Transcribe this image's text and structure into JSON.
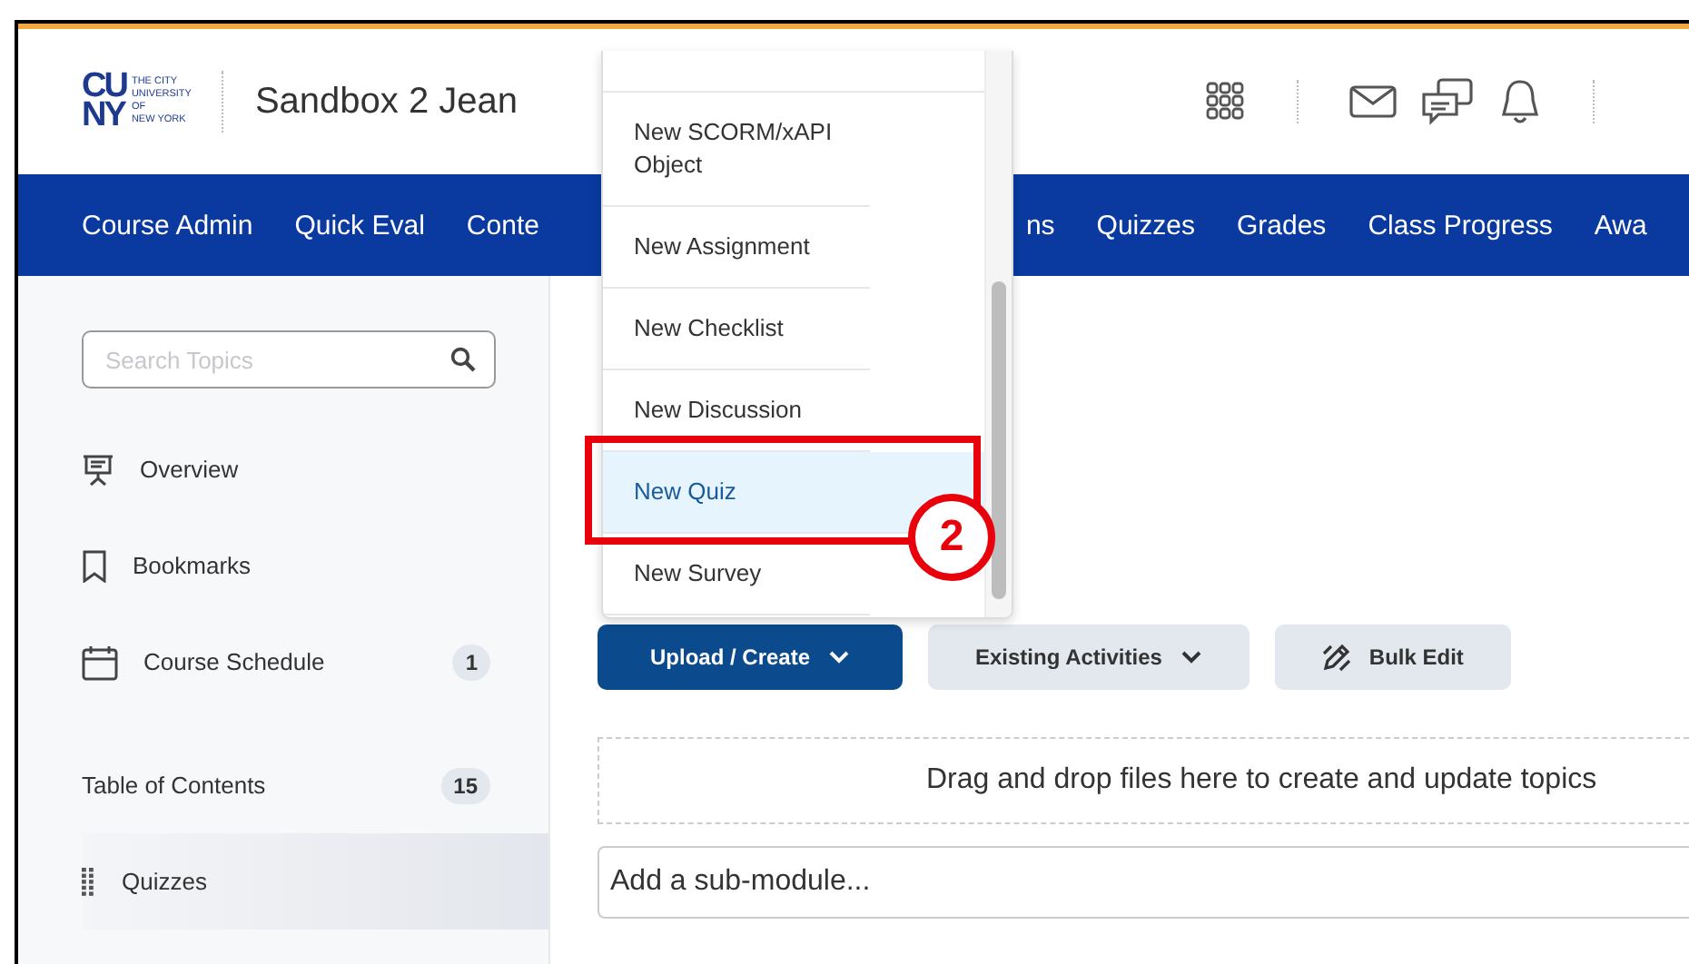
{
  "header": {
    "logo": {
      "mark_lines": [
        "CU",
        "NY"
      ],
      "name_lines": [
        "THE CITY",
        "UNIVERSITY",
        "OF",
        "NEW YORK"
      ]
    },
    "course_title": "Sandbox 2 Jean"
  },
  "nav": {
    "items": [
      "Course Admin",
      "Quick Eval",
      "Conte"
    ],
    "items_after_menu": [
      "ns",
      "Quizzes",
      "Grades",
      "Class Progress",
      "Awa"
    ]
  },
  "sidebar": {
    "search": {
      "placeholder": "Search Topics"
    },
    "items": [
      {
        "kind": "overview",
        "label": "Overview",
        "selected": false
      },
      {
        "kind": "bookmarks",
        "label": "Bookmarks",
        "selected": false
      },
      {
        "kind": "schedule",
        "label": "Course Schedule",
        "count": "1",
        "selected": false
      },
      {
        "kind": "heading",
        "label": "Table of Contents",
        "count": "15",
        "selected": false
      },
      {
        "kind": "module",
        "label": "Quizzes",
        "selected": true
      }
    ]
  },
  "toolbar": {
    "buttons": [
      {
        "kind": "primary",
        "label": "Upload / Create"
      },
      {
        "kind": "dropdown",
        "label": "Existing Activities"
      },
      {
        "kind": "edit",
        "label": "Bulk Edit"
      }
    ]
  },
  "drop_zone": "Drag and drop files here to create and update topics",
  "submodule_field": {
    "placeholder": "Add a sub-module..."
  },
  "menu": {
    "items": [
      {
        "label": "New SCORM/xAPI Object",
        "selected": false
      },
      {
        "label": "New Assignment",
        "selected": false
      },
      {
        "label": "New Checklist",
        "selected": false
      },
      {
        "label": "New Discussion",
        "selected": false
      },
      {
        "label": "New Quiz",
        "selected": true
      },
      {
        "label": "New Survey",
        "selected": false
      }
    ]
  },
  "annotation": {
    "number": "2"
  }
}
